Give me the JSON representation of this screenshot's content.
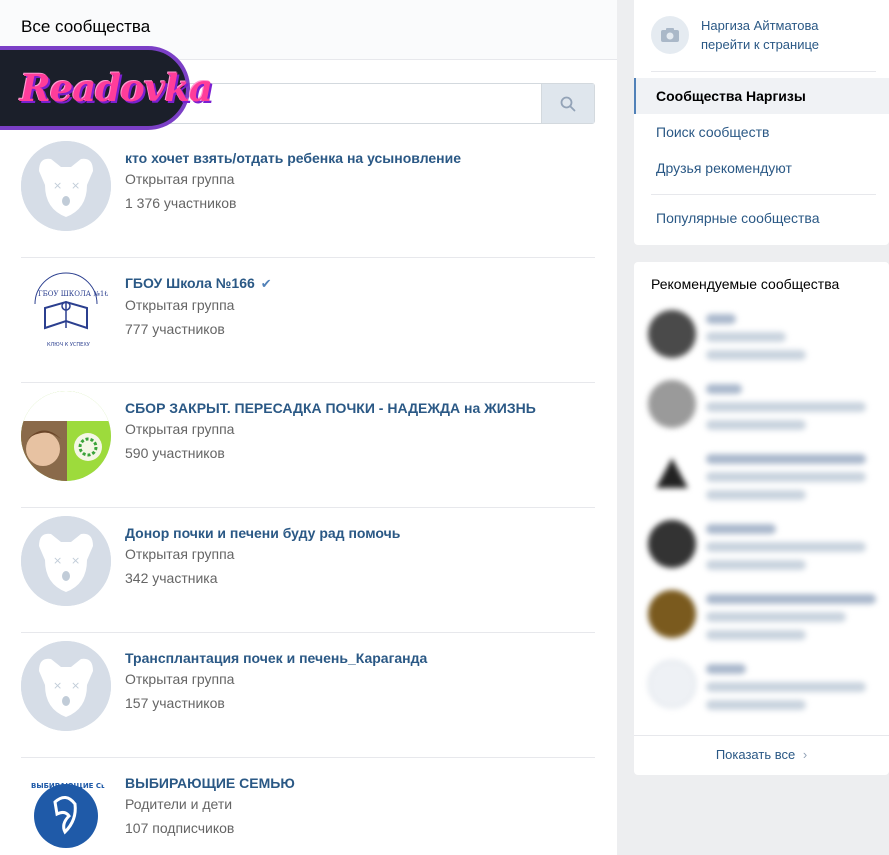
{
  "header": {
    "title": "Все сообщества"
  },
  "search": {
    "placeholder": ""
  },
  "logo": {
    "text": "Readovka"
  },
  "groups": [
    {
      "name": "кто хочет взять/отдать ребенка на усыновление",
      "type": "Открытая группа",
      "members": "1 376 участников",
      "avatar": "deactivated-dog-icon",
      "verified": false
    },
    {
      "name": "ГБОУ Школа №166",
      "type": "Открытая группа",
      "members": "777 участников",
      "avatar": "school-emblem",
      "verified": true
    },
    {
      "name": "СБОР ЗАКРЫТ. ПЕРЕСАДКА ПОЧКИ - НАДЕЖДА на ЖИЗНЬ",
      "type": "Открытая группа",
      "members": "590 участников",
      "avatar": "child-photo",
      "verified": false
    },
    {
      "name": "Донор почки и печени буду рад помочь",
      "type": "Открытая группа",
      "members": "342 участника",
      "avatar": "deactivated-dog-icon",
      "verified": false
    },
    {
      "name": "Трансплантация почек и печень_Караганда",
      "type": "Открытая группа",
      "members": "157 участников",
      "avatar": "deactivated-dog-icon",
      "verified": false
    },
    {
      "name": "ВЫБИРАЮЩИЕ СЕМЬЮ",
      "type": "Родители и дети",
      "members": "107 подписчиков",
      "avatar": "family-logo",
      "verified": false
    }
  ],
  "sidebar": {
    "profile_name": "Наргиза Айтматова",
    "profile_link": "перейти к странице",
    "menu": [
      {
        "label": "Сообщества Наргизы",
        "active": true
      },
      {
        "label": "Поиск сообществ",
        "active": false
      },
      {
        "label": "Друзья рекомендуют",
        "active": false
      },
      {
        "label": "Популярные сообщества",
        "active": false
      }
    ]
  },
  "recommended": {
    "title": "Рекомендуемые сообщества",
    "show_all": "Показать все"
  },
  "colors": {
    "link": "#2a5885",
    "accent": "#5181b8",
    "page_bg": "#edeef0",
    "logo_pink": "#ff3d9a",
    "logo_border": "#7b3fc6"
  }
}
